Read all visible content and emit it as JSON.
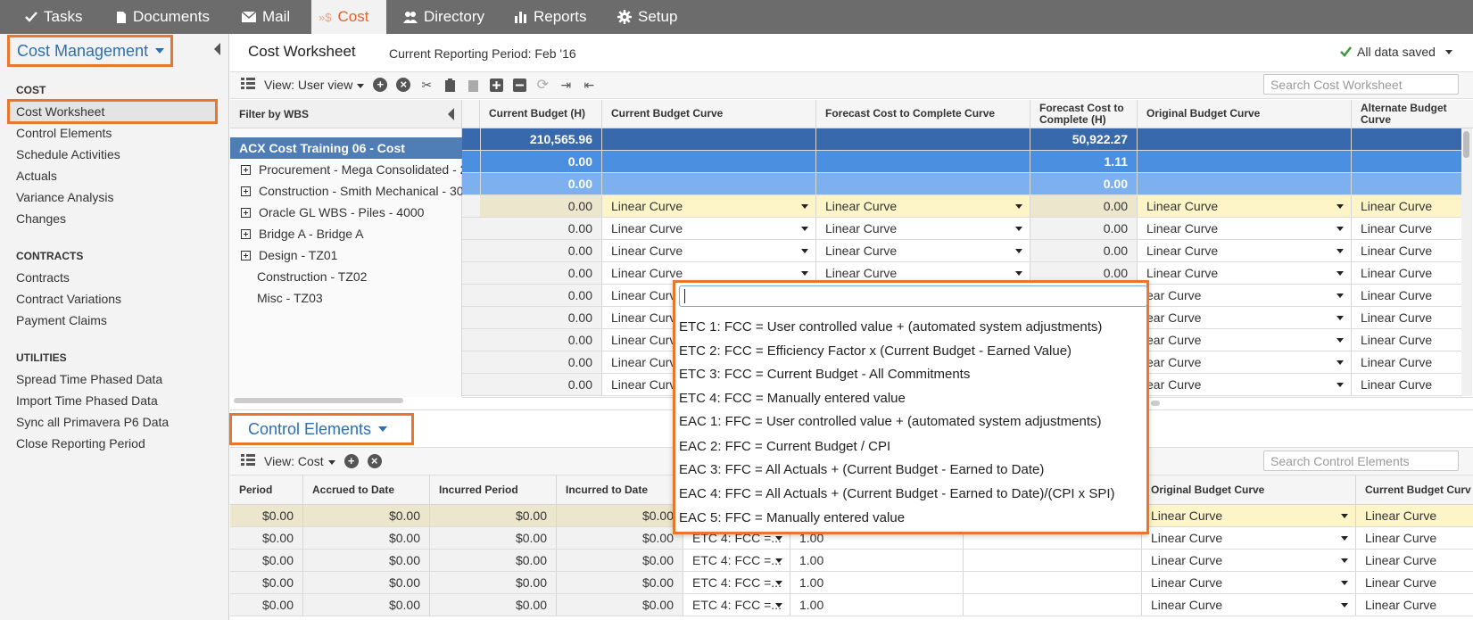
{
  "nav": {
    "tabs": [
      {
        "label": "Tasks",
        "icon": "check-icon"
      },
      {
        "label": "Documents",
        "icon": "document-icon"
      },
      {
        "label": "Mail",
        "icon": "mail-icon"
      },
      {
        "label": "Cost",
        "icon": "cost-icon",
        "active": true
      },
      {
        "label": "Directory",
        "icon": "people-icon"
      },
      {
        "label": "Reports",
        "icon": "bar-chart-icon"
      },
      {
        "label": "Setup",
        "icon": "gear-icon"
      }
    ]
  },
  "sidebar": {
    "module_selector": "Cost Management",
    "sections": [
      {
        "title": "COST",
        "items": [
          "Cost Worksheet",
          "Control Elements",
          "Schedule Activities",
          "Actuals",
          "Variance Analysis",
          "Changes"
        ]
      },
      {
        "title": "CONTRACTS",
        "items": [
          "Contracts",
          "Contract Variations",
          "Payment Claims"
        ]
      },
      {
        "title": "UTILITIES",
        "items": [
          "Spread Time Phased Data",
          "Import Time Phased Data",
          "Sync all Primavera P6 Data",
          "Close Reporting Period"
        ]
      }
    ],
    "selected": "Cost Worksheet"
  },
  "header": {
    "title": "Cost Worksheet",
    "period": "Current Reporting Period: Feb '16",
    "save_status": "All data saved"
  },
  "worksheet": {
    "view_label": "View: User view",
    "search_placeholder": "Search Cost Worksheet",
    "filter_title": "Filter by WBS",
    "wbs_root": "ACX Cost Training 06 - Cost",
    "wbs_items": [
      {
        "label": "Procurement - Mega Consolidated - 2",
        "expandable": true
      },
      {
        "label": "Construction - Smith Mechanical - 30",
        "expandable": true
      },
      {
        "label": "Oracle GL WBS - Piles - 4000",
        "expandable": true
      },
      {
        "label": "Bridge A - Bridge A",
        "expandable": true
      },
      {
        "label": "Design - TZ01",
        "expandable": true
      },
      {
        "label": "Construction - TZ02",
        "expandable": false
      },
      {
        "label": "Misc - TZ03",
        "expandable": false
      }
    ],
    "columns": [
      "Current Budget (H)",
      "Current Budget Curve",
      "Forecast Cost to Complete Curve",
      "Forecast Cost to Complete (H)",
      "Original Budget Curve",
      "Alternate Budget Curve"
    ],
    "summary_rows": [
      {
        "current_budget": "210,565.96",
        "fcc": "50,922.27"
      },
      {
        "current_budget": "0.00",
        "fcc": "1.11"
      },
      {
        "current_budget": "0.00",
        "fcc": "0.00"
      }
    ],
    "rows": [
      {
        "current_budget": "0.00",
        "cb_curve": "Linear Curve",
        "fcc_curve": "Linear Curve",
        "fcc": "0.00",
        "ob_curve": "Linear Curve",
        "alt_curve": "Linear Curve"
      },
      {
        "current_budget": "0.00",
        "cb_curve": "Linear Curve",
        "fcc_curve": "Linear Curve",
        "fcc": "0.00",
        "ob_curve": "Linear Curve",
        "alt_curve": "Linear Curve"
      },
      {
        "current_budget": "0.00",
        "cb_curve": "Linear Curve",
        "fcc_curve": "Linear Curve",
        "fcc": "0.00",
        "ob_curve": "Linear Curve",
        "alt_curve": "Linear Curve"
      },
      {
        "current_budget": "0.00",
        "cb_curve": "Linear Curve",
        "fcc_curve": "Linear Curve",
        "fcc": "0.00",
        "ob_curve": "Linear Curve",
        "alt_curve": "Linear Curve"
      },
      {
        "current_budget": "0.00",
        "cb_curve": "Linear Curve",
        "fcc_curve": "",
        "fcc": "",
        "ob_curve": "ear Curve",
        "alt_curve": "Linear Curve"
      },
      {
        "current_budget": "0.00",
        "cb_curve": "Linear Curve",
        "fcc_curve": "",
        "fcc": "",
        "ob_curve": "ear Curve",
        "alt_curve": "Linear Curve"
      },
      {
        "current_budget": "0.00",
        "cb_curve": "Linear Curve",
        "fcc_curve": "",
        "fcc": "",
        "ob_curve": "ear Curve",
        "alt_curve": "Linear Curve"
      },
      {
        "current_budget": "0.00",
        "cb_curve": "Linear Curve",
        "fcc_curve": "",
        "fcc": "",
        "ob_curve": "ear Curve",
        "alt_curve": "Linear Curve"
      },
      {
        "current_budget": "0.00",
        "cb_curve": "Linear Curve",
        "fcc_curve": "",
        "fcc": "",
        "ob_curve": "ear Curve",
        "alt_curve": "Linear Curve"
      }
    ]
  },
  "dropdown": {
    "search_value": "",
    "options": [
      "ETC 1: FCC = User controlled value + (automated system adjustments)",
      "ETC 2: FCC = Efficiency Factor x (Current Budget - Earned Value)",
      "ETC 3: FCC = Current Budget - All Commitments",
      "ETC 4: FCC = Manually entered value",
      "EAC 1: FFC = User controlled value + (automated system adjustments)",
      "EAC 2: FFC = Current Budget / CPI",
      "EAC 3: FFC = All Actuals + (Current Budget - Earned to Date)",
      "EAC 4: FFC = All Actuals + (Current Budget - Earned to Date)/(CPI x SPI)",
      "EAC 5: FFC = Manually entered value"
    ]
  },
  "control_elements": {
    "title": "Control Elements",
    "view_label": "View: Cost",
    "search_placeholder": "Search Control Elements",
    "columns": [
      "Period",
      "Accrued to Date",
      "Incurred Period",
      "Incurred to Date",
      "",
      "",
      "",
      "Original Budget Curve",
      "Current Budget Curv"
    ],
    "rows": [
      {
        "period": "$0.00",
        "accrued": "$0.00",
        "inc_period": "$0.00",
        "inc_to_date": "$0.00",
        "method": "",
        "factor": "",
        "ob_curve": "Linear Curve",
        "cb_curve": "Linear Curve"
      },
      {
        "period": "$0.00",
        "accrued": "$0.00",
        "inc_period": "$0.00",
        "inc_to_date": "$0.00",
        "method": "ETC 4: FCC =...",
        "factor": "1.00",
        "ob_curve": "Linear Curve",
        "cb_curve": "Linear Curve"
      },
      {
        "period": "$0.00",
        "accrued": "$0.00",
        "inc_period": "$0.00",
        "inc_to_date": "$0.00",
        "method": "ETC 4: FCC =...",
        "factor": "1.00",
        "ob_curve": "Linear Curve",
        "cb_curve": "Linear Curve"
      },
      {
        "period": "$0.00",
        "accrued": "$0.00",
        "inc_period": "$0.00",
        "inc_to_date": "$0.00",
        "method": "ETC 4: FCC =...",
        "factor": "1.00",
        "ob_curve": "Linear Curve",
        "cb_curve": "Linear Curve"
      },
      {
        "period": "$0.00",
        "accrued": "$0.00",
        "inc_period": "$0.00",
        "inc_to_date": "$0.00",
        "method": "ETC 4: FCC =...",
        "factor": "1.00",
        "ob_curve": "Linear Curve",
        "cb_curve": "Linear Curve"
      }
    ]
  },
  "colors": {
    "accent": "#e8612c",
    "highlight_border": "#e8762c",
    "link_blue": "#2b6fb5",
    "row_selected": "#fdf5c8",
    "summary_dark": "#3869ac",
    "summary_mid": "#4a8fe0",
    "summary_light": "#7cb0ee"
  }
}
